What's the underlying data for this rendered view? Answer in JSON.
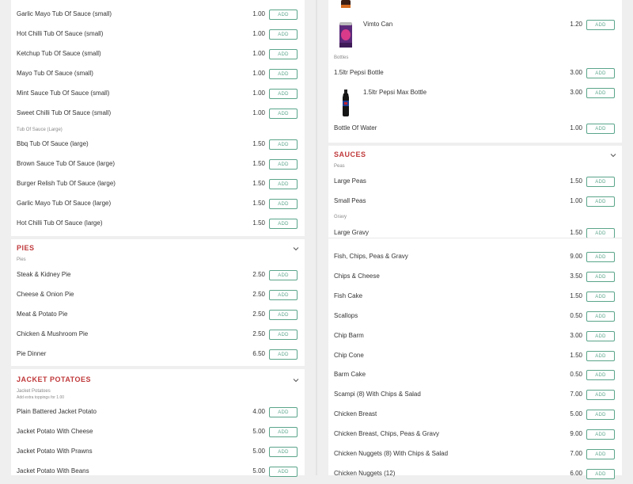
{
  "add_label": "ADD",
  "left": {
    "sauce_small_items": [
      {
        "name": "Garlic Mayo Tub Of Sauce (small)",
        "price": "1.00"
      },
      {
        "name": "Hot Chilli Tub Of Sauce (small)",
        "price": "1.00"
      },
      {
        "name": "Ketchup Tub Of Sauce (small)",
        "price": "1.00"
      },
      {
        "name": "Mayo Tub Of Sauce (small)",
        "price": "1.00"
      },
      {
        "name": "Mint Sauce Tub Of Sauce (small)",
        "price": "1.00"
      },
      {
        "name": "Sweet Chilli Tub Of Sauce (small)",
        "price": "1.00"
      }
    ],
    "sauce_large_heading": "Tub Of Sauce (Large)",
    "sauce_large_items": [
      {
        "name": "Bbq Tub Of Sauce (large)",
        "price": "1.50"
      },
      {
        "name": "Brown Sauce Tub Of Sauce (large)",
        "price": "1.50"
      },
      {
        "name": "Burger Relish Tub Of Sauce (large)",
        "price": "1.50"
      },
      {
        "name": "Garlic Mayo Tub Of Sauce (large)",
        "price": "1.50"
      },
      {
        "name": "Hot Chilli Tub Of Sauce (large)",
        "price": "1.50"
      }
    ],
    "pies": {
      "title": "PIES",
      "subheading": "Pies",
      "items": [
        {
          "name": "Steak & Kidney Pie",
          "price": "2.50"
        },
        {
          "name": "Cheese & Onion Pie",
          "price": "2.50"
        },
        {
          "name": "Meat & Potato Pie",
          "price": "2.50"
        },
        {
          "name": "Chicken & Mushroom Pie",
          "price": "2.50"
        },
        {
          "name": "Pie Dinner",
          "price": "6.50"
        }
      ]
    },
    "jacket": {
      "title": "JACKET POTATOES",
      "subheading": "Jacket Potatoes",
      "note": "Add extra toppings for 1.00",
      "items": [
        {
          "name": "Plain Battered Jacket Potato",
          "price": "4.00"
        },
        {
          "name": "Jacket Potato With Cheese",
          "price": "5.00"
        },
        {
          "name": "Jacket Potato With Prawns",
          "price": "5.00"
        },
        {
          "name": "Jacket Potato With Beans",
          "price": "5.00"
        }
      ]
    }
  },
  "right": {
    "cans": [
      {
        "name": "Vimto Can",
        "price": "1.20"
      }
    ],
    "bottles_heading": "Bottles",
    "bottles": [
      {
        "name": "1.5ltr Pepsi Bottle",
        "price": "3.00"
      },
      {
        "name": "1.5ltr Pepsi Max Bottle",
        "price": "3.00"
      },
      {
        "name": "Bottle Of Water",
        "price": "1.00"
      }
    ],
    "sauces": {
      "title": "SAUCES",
      "peas_heading": "Peas",
      "peas": [
        {
          "name": "Large Peas",
          "price": "1.50"
        },
        {
          "name": "Small Peas",
          "price": "1.00"
        }
      ],
      "gravy_heading": "Gravy",
      "gravy": [
        {
          "name": "Large Gravy",
          "price": "1.50"
        }
      ]
    },
    "mains": [
      {
        "name": "Fish, Chips, Peas & Gravy",
        "price": "9.00"
      },
      {
        "name": "Chips & Cheese",
        "price": "3.50"
      },
      {
        "name": "Fish Cake",
        "price": "1.50"
      },
      {
        "name": "Scallops",
        "price": "0.50"
      },
      {
        "name": "Chip Barm",
        "price": "3.00"
      },
      {
        "name": "Chip Cone",
        "price": "1.50"
      },
      {
        "name": "Barm Cake",
        "price": "0.50"
      },
      {
        "name": "Scampi (8) With Chips & Salad",
        "price": "7.00"
      },
      {
        "name": "Chicken Breast",
        "price": "5.00"
      },
      {
        "name": "Chicken Breast, Chips, Peas & Gravy",
        "price": "9.00"
      },
      {
        "name": "Chicken Nuggets (8) With Chips & Salad",
        "price": "7.00"
      },
      {
        "name": "Chicken Nuggets (12)",
        "price": "6.00"
      }
    ]
  }
}
